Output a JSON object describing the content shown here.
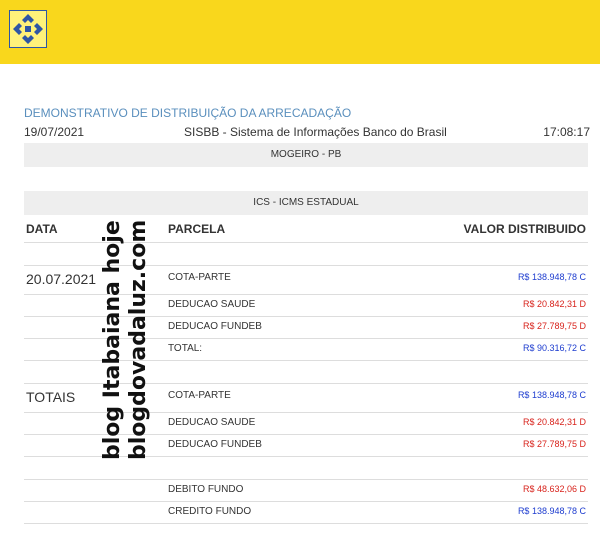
{
  "header": {
    "brand_color": "#f9d71c",
    "logo_icon": "banco-do-brasil-logo"
  },
  "document": {
    "title": "DEMONSTRATIVO DE DISTRIBUIÇÃO DA ARRECADAÇÃO",
    "date": "19/07/2021",
    "system": "SISBB - Sistema de Informações Banco do Brasil",
    "time": "17:08:17",
    "municipality": "MOGEIRO - PB",
    "tax_type": "ICS - ICMS ESTADUAL"
  },
  "table": {
    "columns": {
      "data": "DATA",
      "parcela": "PARCELA",
      "valor": "VALOR DISTRIBUIDO"
    },
    "groups": [
      {
        "date": "20.07.2021",
        "rows": [
          {
            "parcela": "COTA-PARTE",
            "valor": "R$ 138.948,78 C",
            "color": "#1d3ccf"
          },
          {
            "parcela": "DEDUCAO SAUDE",
            "valor": "R$ 20.842,31 D",
            "color": "#d8231c"
          },
          {
            "parcela": "DEDUCAO FUNDEB",
            "valor": "R$ 27.789,75 D",
            "color": "#d8231c"
          },
          {
            "parcela": "TOTAL:",
            "valor": "R$ 90.316,72 C",
            "color": "#1d3ccf"
          }
        ]
      },
      {
        "date": "TOTAIS",
        "rows": [
          {
            "parcela": "COTA-PARTE",
            "valor": "R$ 138.948,78 C",
            "color": "#1d3ccf"
          },
          {
            "parcela": "DEDUCAO SAUDE",
            "valor": "R$ 20.842,31 D",
            "color": "#d8231c"
          },
          {
            "parcela": "DEDUCAO FUNDEB",
            "valor": "R$ 27.789,75 D",
            "color": "#d8231c"
          }
        ]
      }
    ],
    "fund_rows": [
      {
        "parcela": "DEBITO FUNDO",
        "valor": "R$ 48.632,06 D",
        "color": "#d8231c"
      },
      {
        "parcela": "CREDITO FUNDO",
        "valor": "R$ 138.948,78 C",
        "color": "#1d3ccf"
      }
    ]
  },
  "watermark": {
    "line1": "blog Itabaiana hoje",
    "line2": "blogdovadaluz.com"
  }
}
